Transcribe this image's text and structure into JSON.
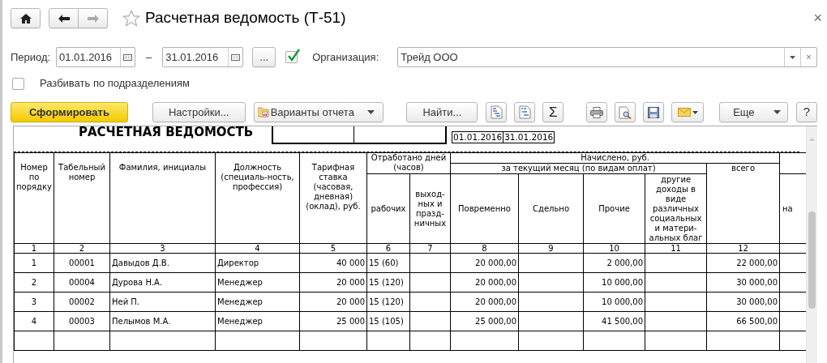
{
  "window": {
    "title": "Расчетная ведомость (Т-51)",
    "close": "×"
  },
  "period": {
    "label": "Период:",
    "from": "01.01.2016",
    "dash": "–",
    "to": "31.01.2016",
    "more": "...",
    "org_filter_on": true,
    "org_label": "Организация:",
    "org_value": "Трейд ООО",
    "clear": "×"
  },
  "split_by_departments": {
    "label": "Разбивать по подразделениям",
    "checked": false
  },
  "toolbar": {
    "generate": "Сформировать",
    "settings": "Настройки...",
    "variants": "Варианты отчета",
    "find": "Найти...",
    "sum": "Σ",
    "more": "Еще",
    "help": "?"
  },
  "report": {
    "title": "РАСЧЕТНАЯ ВЕДОМОСТЬ",
    "date_from": "01.01.2016",
    "date_to": "31.01.2016",
    "header_rows": [
      [
        {
          "text": "Номер по порядку",
          "rowspan": 3
        },
        {
          "text": "Табельный номер",
          "rowspan": 3
        },
        {
          "text": "Фамилия, инициалы",
          "rowspan": 3
        },
        {
          "text": "Должность (специаль-ность, профессия)",
          "rowspan": 3
        },
        {
          "text": "Тарифная ставка (часовая, дневная) (оклад), руб.",
          "rowspan": 3
        },
        {
          "text": "Отработано дней (часов)",
          "colspan": 2,
          "rowspan": 2
        },
        {
          "text": "Начислено, руб.",
          "colspan": 5
        },
        {
          "rowspan": 2
        }
      ],
      [
        {
          "text": "за текущий месяц (по видам оплат)",
          "colspan": 4
        },
        {
          "text": "всего",
          "rowspan": 2
        }
      ],
      [
        {
          "text": "рабочих"
        },
        {
          "text": "выход-ных и празд-ничных"
        },
        {
          "text": "Повременно"
        },
        {
          "text": "Сдельно"
        },
        {
          "text": "Прочие"
        },
        {
          "text": "другие доходы в виде различных социальных и матери-альных благ"
        },
        {
          "text": "на"
        }
      ]
    ],
    "column_numbers": [
      "1",
      "2",
      "3",
      "4",
      "5",
      "6",
      "7",
      "8",
      "9",
      "10",
      "11",
      "12"
    ],
    "rows": [
      {
        "number": "1",
        "personnel_no": "00001",
        "name": "Давыдов Д.В.",
        "position": "Директор",
        "rate": "40 000",
        "work_days": "15 (60)",
        "time_pay": "20 000,00",
        "other_pay": "2 000,00",
        "total": "22 000,00"
      },
      {
        "number": "2",
        "personnel_no": "00004",
        "name": "Дурова Н.А.",
        "position": "Менеджер",
        "rate": "20 000",
        "work_days": "15 (120)",
        "time_pay": "20 000,00",
        "other_pay": "10 000,00",
        "total": "30 000,00"
      },
      {
        "number": "3",
        "personnel_no": "00002",
        "name": "Ней П.",
        "position": "Менеджер",
        "rate": "20 000",
        "work_days": "15 (120)",
        "time_pay": "20 000,00",
        "other_pay": "10 000,00",
        "total": "30 000,00"
      },
      {
        "number": "4",
        "personnel_no": "00003",
        "name": "Пелымов М.А.",
        "position": "Менеджер",
        "rate": "25 000",
        "work_days": "15 (105)",
        "time_pay": "25 000,00",
        "other_pay": "41 500,00",
        "total": "66 500,00"
      }
    ]
  }
}
